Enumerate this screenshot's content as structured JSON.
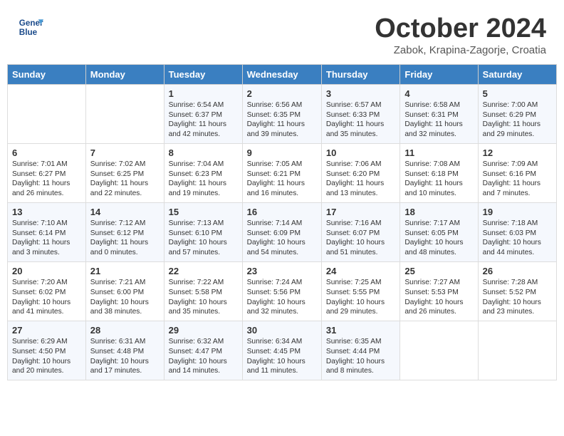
{
  "header": {
    "logo_line1": "General",
    "logo_line2": "Blue",
    "month": "October 2024",
    "location": "Zabok, Krapina-Zagorje, Croatia"
  },
  "days_of_week": [
    "Sunday",
    "Monday",
    "Tuesday",
    "Wednesday",
    "Thursday",
    "Friday",
    "Saturday"
  ],
  "weeks": [
    [
      {
        "day": "",
        "content": ""
      },
      {
        "day": "",
        "content": ""
      },
      {
        "day": "1",
        "content": "Sunrise: 6:54 AM\nSunset: 6:37 PM\nDaylight: 11 hours and 42 minutes."
      },
      {
        "day": "2",
        "content": "Sunrise: 6:56 AM\nSunset: 6:35 PM\nDaylight: 11 hours and 39 minutes."
      },
      {
        "day": "3",
        "content": "Sunrise: 6:57 AM\nSunset: 6:33 PM\nDaylight: 11 hours and 35 minutes."
      },
      {
        "day": "4",
        "content": "Sunrise: 6:58 AM\nSunset: 6:31 PM\nDaylight: 11 hours and 32 minutes."
      },
      {
        "day": "5",
        "content": "Sunrise: 7:00 AM\nSunset: 6:29 PM\nDaylight: 11 hours and 29 minutes."
      }
    ],
    [
      {
        "day": "6",
        "content": "Sunrise: 7:01 AM\nSunset: 6:27 PM\nDaylight: 11 hours and 26 minutes."
      },
      {
        "day": "7",
        "content": "Sunrise: 7:02 AM\nSunset: 6:25 PM\nDaylight: 11 hours and 22 minutes."
      },
      {
        "day": "8",
        "content": "Sunrise: 7:04 AM\nSunset: 6:23 PM\nDaylight: 11 hours and 19 minutes."
      },
      {
        "day": "9",
        "content": "Sunrise: 7:05 AM\nSunset: 6:21 PM\nDaylight: 11 hours and 16 minutes."
      },
      {
        "day": "10",
        "content": "Sunrise: 7:06 AM\nSunset: 6:20 PM\nDaylight: 11 hours and 13 minutes."
      },
      {
        "day": "11",
        "content": "Sunrise: 7:08 AM\nSunset: 6:18 PM\nDaylight: 11 hours and 10 minutes."
      },
      {
        "day": "12",
        "content": "Sunrise: 7:09 AM\nSunset: 6:16 PM\nDaylight: 11 hours and 7 minutes."
      }
    ],
    [
      {
        "day": "13",
        "content": "Sunrise: 7:10 AM\nSunset: 6:14 PM\nDaylight: 11 hours and 3 minutes."
      },
      {
        "day": "14",
        "content": "Sunrise: 7:12 AM\nSunset: 6:12 PM\nDaylight: 11 hours and 0 minutes."
      },
      {
        "day": "15",
        "content": "Sunrise: 7:13 AM\nSunset: 6:10 PM\nDaylight: 10 hours and 57 minutes."
      },
      {
        "day": "16",
        "content": "Sunrise: 7:14 AM\nSunset: 6:09 PM\nDaylight: 10 hours and 54 minutes."
      },
      {
        "day": "17",
        "content": "Sunrise: 7:16 AM\nSunset: 6:07 PM\nDaylight: 10 hours and 51 minutes."
      },
      {
        "day": "18",
        "content": "Sunrise: 7:17 AM\nSunset: 6:05 PM\nDaylight: 10 hours and 48 minutes."
      },
      {
        "day": "19",
        "content": "Sunrise: 7:18 AM\nSunset: 6:03 PM\nDaylight: 10 hours and 44 minutes."
      }
    ],
    [
      {
        "day": "20",
        "content": "Sunrise: 7:20 AM\nSunset: 6:02 PM\nDaylight: 10 hours and 41 minutes."
      },
      {
        "day": "21",
        "content": "Sunrise: 7:21 AM\nSunset: 6:00 PM\nDaylight: 10 hours and 38 minutes."
      },
      {
        "day": "22",
        "content": "Sunrise: 7:22 AM\nSunset: 5:58 PM\nDaylight: 10 hours and 35 minutes."
      },
      {
        "day": "23",
        "content": "Sunrise: 7:24 AM\nSunset: 5:56 PM\nDaylight: 10 hours and 32 minutes."
      },
      {
        "day": "24",
        "content": "Sunrise: 7:25 AM\nSunset: 5:55 PM\nDaylight: 10 hours and 29 minutes."
      },
      {
        "day": "25",
        "content": "Sunrise: 7:27 AM\nSunset: 5:53 PM\nDaylight: 10 hours and 26 minutes."
      },
      {
        "day": "26",
        "content": "Sunrise: 7:28 AM\nSunset: 5:52 PM\nDaylight: 10 hours and 23 minutes."
      }
    ],
    [
      {
        "day": "27",
        "content": "Sunrise: 6:29 AM\nSunset: 4:50 PM\nDaylight: 10 hours and 20 minutes."
      },
      {
        "day": "28",
        "content": "Sunrise: 6:31 AM\nSunset: 4:48 PM\nDaylight: 10 hours and 17 minutes."
      },
      {
        "day": "29",
        "content": "Sunrise: 6:32 AM\nSunset: 4:47 PM\nDaylight: 10 hours and 14 minutes."
      },
      {
        "day": "30",
        "content": "Sunrise: 6:34 AM\nSunset: 4:45 PM\nDaylight: 10 hours and 11 minutes."
      },
      {
        "day": "31",
        "content": "Sunrise: 6:35 AM\nSunset: 4:44 PM\nDaylight: 10 hours and 8 minutes."
      },
      {
        "day": "",
        "content": ""
      },
      {
        "day": "",
        "content": ""
      }
    ]
  ]
}
